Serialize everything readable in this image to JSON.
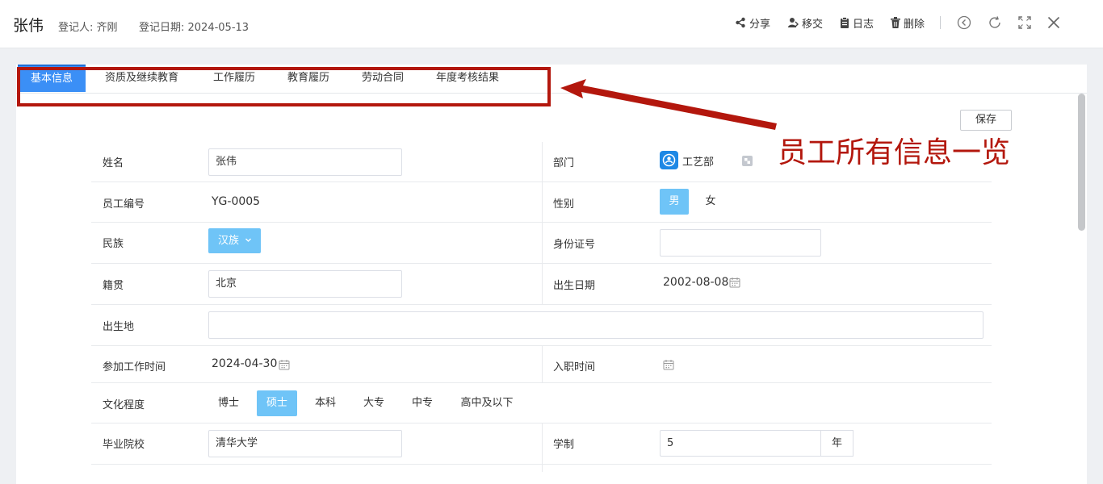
{
  "header": {
    "name": "张伟",
    "registrar": "登记人: 齐刚",
    "reg_date": "登记日期: 2024-05-13",
    "actions": {
      "share": "分享",
      "transfer": "移交",
      "log": "日志",
      "delete": "删除"
    }
  },
  "tabs": [
    "基本信息",
    "资质及继续教育",
    "工作履历",
    "教育履历",
    "劳动合同",
    "年度考核结果"
  ],
  "annotation": "员工所有信息一览",
  "save_label": "保存",
  "form": {
    "name_label": "姓名",
    "name_value": "张伟",
    "dept_label": "部门",
    "dept_value": "工艺部",
    "emp_no_label": "员工编号",
    "emp_no_value": "YG-0005",
    "gender_label": "性别",
    "gender_options": [
      "男",
      "女"
    ],
    "gender_selected": "男",
    "ethnic_label": "民族",
    "ethnic_value": "汉族",
    "id_label": "身份证号",
    "id_value": "",
    "native_label": "籍贯",
    "native_value": "北京",
    "birth_label": "出生日期",
    "birth_value": "2002-08-08",
    "birthplace_label": "出生地",
    "birthplace_value": "",
    "work_start_label": "参加工作时间",
    "work_start_value": "2024-04-30",
    "hire_label": "入职时间",
    "hire_value": "",
    "edu_label": "文化程度",
    "edu_options": [
      "博士",
      "硕士",
      "本科",
      "大专",
      "中专",
      "高中及以下"
    ],
    "edu_selected": "硕士",
    "school_label": "毕业院校",
    "school_value": "清华大学",
    "duration_label": "学制",
    "duration_value": "5",
    "duration_unit": "年"
  },
  "colors": {
    "accent": "#3b8ff6",
    "selected_option": "#6fc4f7",
    "annotation": "#b3170d"
  }
}
